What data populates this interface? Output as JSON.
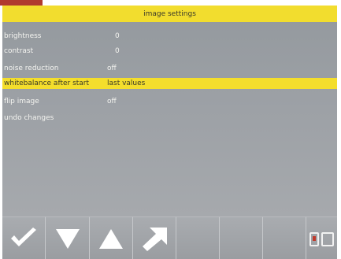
{
  "header": {
    "title": "image settings"
  },
  "menu": {
    "items": [
      {
        "label": "brightness",
        "value": "0"
      },
      {
        "label": "contrast",
        "value": "0"
      },
      {
        "label": "noise reduction",
        "value": "off"
      },
      {
        "label": "whitebalance after start",
        "value": "last values",
        "selected": true
      },
      {
        "label": "flip image",
        "value": "off"
      },
      {
        "label": "undo changes",
        "value": ""
      }
    ]
  },
  "toolbar": {
    "buttons": [
      {
        "icon": "checkmark-icon"
      },
      {
        "icon": "arrow-down-icon"
      },
      {
        "icon": "arrow-up-icon"
      },
      {
        "icon": "arrow-diagonal-icon"
      },
      {
        "icon": ""
      },
      {
        "icon": ""
      },
      {
        "icon": ""
      },
      {
        "icon": "battery-card-icon"
      }
    ]
  },
  "colors": {
    "accent_yellow": "#f4de2c",
    "brand_red": "#b03a2e",
    "panel_gray": "#9da1a6"
  }
}
